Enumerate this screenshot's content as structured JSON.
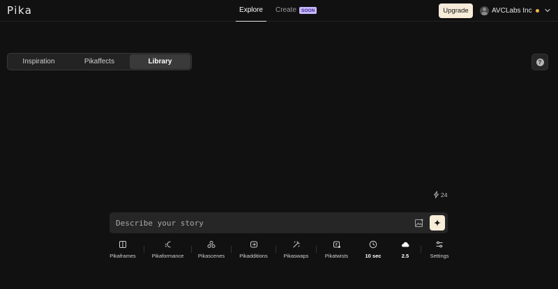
{
  "header": {
    "logo": "Pika",
    "nav": [
      {
        "label": "Explore"
      },
      {
        "label": "Create",
        "badge": "SOON"
      }
    ],
    "upgrade_label": "Upgrade",
    "account_name": "AVCLabs Inc"
  },
  "subtabs": [
    {
      "label": "Inspiration"
    },
    {
      "label": "Pikaffects"
    },
    {
      "label": "Library",
      "active": true
    }
  ],
  "help_icon": "question-icon",
  "credits": {
    "value": "24",
    "icon": "lightning-icon"
  },
  "prompt": {
    "placeholder": "Describe your story"
  },
  "toolbar": [
    {
      "label": "Pikaframes",
      "icon": "frames-icon"
    },
    {
      "label": "Pikaformance",
      "icon": "performance-icon"
    },
    {
      "label": "Pikascenes",
      "icon": "scenes-icon"
    },
    {
      "label": "Pikadditions",
      "icon": "additions-icon"
    },
    {
      "label": "Pikaswaps",
      "icon": "swaps-icon"
    },
    {
      "label": "Pikatwists",
      "icon": "twists-icon"
    },
    {
      "label": "10 sec",
      "icon": "clock-icon"
    },
    {
      "label": "2.5",
      "icon": "cloud-icon"
    },
    {
      "label": "Settings",
      "icon": "settings-icon"
    }
  ],
  "colors": {
    "background": "#111111",
    "accent": "#f6ecd8",
    "badge": "#c9b9ff",
    "status_dot": "#f2b84a"
  }
}
